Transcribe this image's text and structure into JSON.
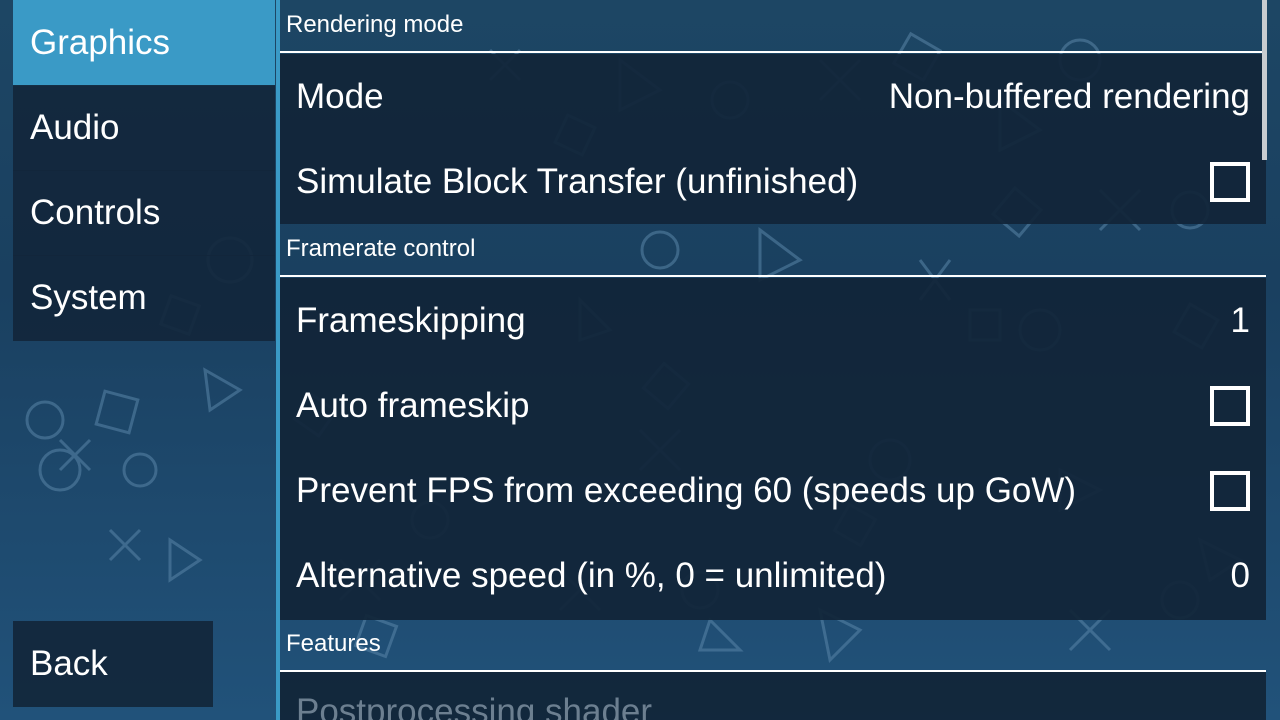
{
  "sidebar": {
    "tabs": [
      {
        "label": "Graphics",
        "active": true
      },
      {
        "label": "Audio",
        "active": false
      },
      {
        "label": "Controls",
        "active": false
      },
      {
        "label": "System",
        "active": false
      }
    ],
    "back_label": "Back"
  },
  "sections": {
    "rendering": {
      "header": "Rendering mode",
      "mode_label": "Mode",
      "mode_value": "Non-buffered rendering",
      "block_transfer_label": "Simulate Block Transfer (unfinished)",
      "block_transfer_checked": false
    },
    "framerate": {
      "header": "Framerate control",
      "frameskipping_label": "Frameskipping",
      "frameskipping_value": "1",
      "auto_frameskip_label": "Auto frameskip",
      "auto_frameskip_checked": false,
      "prevent_fps_label": "Prevent FPS from exceeding 60 (speeds up GoW)",
      "prevent_fps_checked": false,
      "alt_speed_label": "Alternative speed (in %, 0 = unlimited)",
      "alt_speed_value": "0"
    },
    "features": {
      "header": "Features",
      "postprocessing_label": "Postprocessing shader"
    }
  },
  "colors": {
    "accent": "#3a9ac6",
    "background": "#1d4664",
    "panel": "#12273b",
    "disabled_text": "#6c7f90"
  }
}
